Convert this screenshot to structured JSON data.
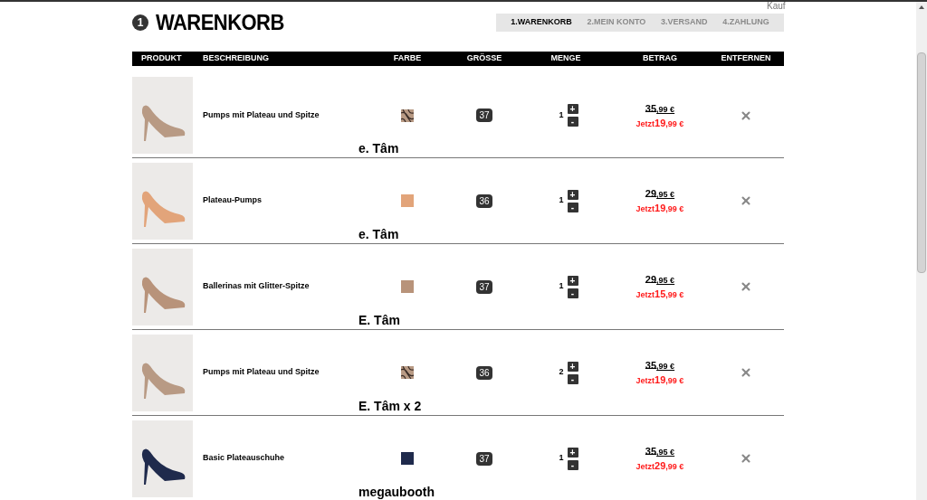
{
  "top_link": "Kauf",
  "step_number": "1",
  "title": "WARENKORB",
  "steps": [
    {
      "label": "1.WARENKORB",
      "selected": true
    },
    {
      "label": "2.MEIN KONTO",
      "selected": false
    },
    {
      "label": "3.VERSAND",
      "selected": false
    },
    {
      "label": "4.ZAHLUNG",
      "selected": false
    }
  ],
  "table": {
    "columns": [
      "PRODUKT",
      "BESCHREIBUNG",
      "FARBE",
      "GRÖSSE",
      "MENGE",
      "BETRAG",
      "ENTFERNEN"
    ],
    "rows": [
      {
        "description": "Pumps mit Plateau und Spitze",
        "swatch": {
          "kind": "lace",
          "color": "#b89a84"
        },
        "size": "37",
        "quantity": "1",
        "plus": "+",
        "minus": "-",
        "old_price": {
          "main": "35",
          "cents": ",99 €"
        },
        "new_price": {
          "prefix": "Jetzt",
          "main": "19",
          "cents": ",99 €"
        },
        "annotation": "e. Tâm"
      },
      {
        "description": "Plateau-Pumps",
        "swatch": {
          "kind": "solid",
          "color": "#e2a47a"
        },
        "size": "36",
        "quantity": "1",
        "plus": "+",
        "minus": "-",
        "old_price": {
          "main": "29",
          "cents": ",95 €"
        },
        "new_price": {
          "prefix": "Jetzt",
          "main": "19",
          "cents": ",99 €"
        },
        "annotation": "e. Tâm"
      },
      {
        "description": "Ballerinas mit Glitter-Spitze",
        "swatch": {
          "kind": "solid",
          "color": "#b8937a"
        },
        "size": "37",
        "quantity": "1",
        "plus": "+",
        "minus": "-",
        "old_price": {
          "main": "29",
          "cents": ",95 €"
        },
        "new_price": {
          "prefix": "Jetzt",
          "main": "15",
          "cents": ",99 €"
        },
        "annotation": "E. Tâm"
      },
      {
        "description": "Pumps mit Plateau und Spitze",
        "swatch": {
          "kind": "lace",
          "color": "#b89a84"
        },
        "size": "36",
        "quantity": "2",
        "plus": "+",
        "minus": "-",
        "old_price": {
          "main": "35",
          "cents": ",99 €"
        },
        "new_price": {
          "prefix": "Jetzt",
          "main": "19",
          "cents": ",99 €"
        },
        "annotation": "E. Tâm x 2"
      },
      {
        "description": "Basic Plateauschuhe",
        "swatch": {
          "kind": "solid",
          "color": "#1f2a4c"
        },
        "size": "37",
        "quantity": "1",
        "plus": "+",
        "minus": "-",
        "old_price": {
          "main": "35",
          "cents": ",95 €"
        },
        "new_price": {
          "prefix": "Jetzt",
          "main": "29",
          "cents": ",99 €"
        },
        "annotation": "megaubooth"
      }
    ]
  }
}
